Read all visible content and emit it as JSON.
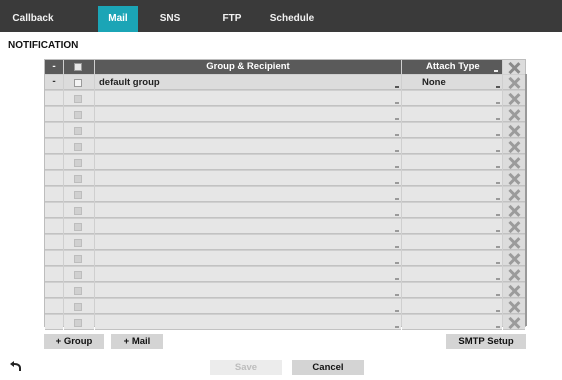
{
  "tabs": [
    {
      "label": "Callback",
      "active": false
    },
    {
      "label": "Mail",
      "active": true
    },
    {
      "label": "SNS",
      "active": false
    },
    {
      "label": "FTP",
      "active": false
    },
    {
      "label": "Schedule",
      "active": false
    }
  ],
  "section_title": "NOTIFICATION",
  "table": {
    "headers": {
      "minus": "-",
      "group": "Group & Recipient",
      "attach": "Attach Type"
    },
    "rows": [
      {
        "minus": "-",
        "group": "default group",
        "attach": "None"
      },
      {
        "minus": "",
        "group": "",
        "attach": ""
      },
      {
        "minus": "",
        "group": "",
        "attach": ""
      },
      {
        "minus": "",
        "group": "",
        "attach": ""
      },
      {
        "minus": "",
        "group": "",
        "attach": ""
      },
      {
        "minus": "",
        "group": "",
        "attach": ""
      },
      {
        "minus": "",
        "group": "",
        "attach": ""
      },
      {
        "minus": "",
        "group": "",
        "attach": ""
      },
      {
        "minus": "",
        "group": "",
        "attach": ""
      },
      {
        "minus": "",
        "group": "",
        "attach": ""
      },
      {
        "minus": "",
        "group": "",
        "attach": ""
      },
      {
        "minus": "",
        "group": "",
        "attach": ""
      },
      {
        "minus": "",
        "group": "",
        "attach": ""
      },
      {
        "minus": "",
        "group": "",
        "attach": ""
      },
      {
        "minus": "",
        "group": "",
        "attach": ""
      },
      {
        "minus": "",
        "group": "",
        "attach": ""
      }
    ]
  },
  "buttons": {
    "add_group": "+ Group",
    "add_mail": "+ Mail",
    "smtp_setup": "SMTP Setup",
    "save": "Save",
    "cancel": "Cancel"
  },
  "colors": {
    "accent": "#1ba5b6",
    "tabbar": "#3a3a3a",
    "header": "#5a5a5a"
  }
}
